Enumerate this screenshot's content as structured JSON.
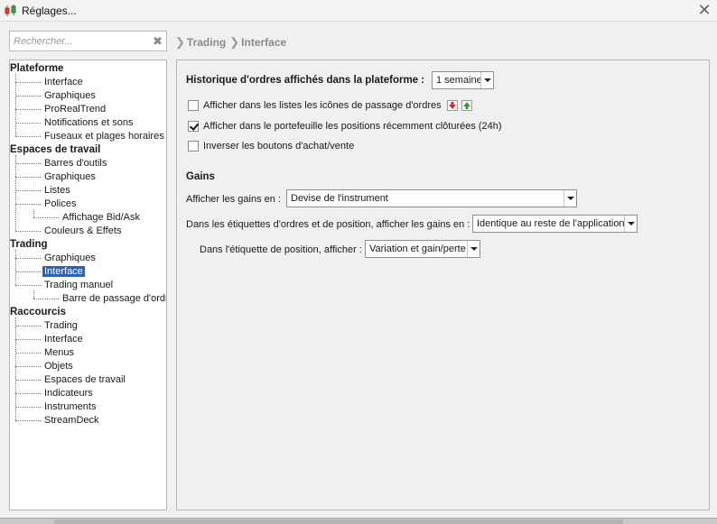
{
  "window": {
    "title": "Réglages..."
  },
  "search": {
    "placeholder": "Rechercher..."
  },
  "breadcrumb": [
    "Trading",
    "Interface"
  ],
  "tree": [
    {
      "label": "Plateforme",
      "level": 0,
      "name": "tree-cat-plateforme"
    },
    {
      "label": "Interface",
      "level": 1,
      "name": "tree-item-plateforme-interface"
    },
    {
      "label": "Graphiques",
      "level": 1,
      "name": "tree-item-plateforme-graphiques"
    },
    {
      "label": "ProRealTrend",
      "level": 1,
      "name": "tree-item-prorealtrend"
    },
    {
      "label": "Notifications et sons",
      "level": 1,
      "name": "tree-item-notifications"
    },
    {
      "label": "Fuseaux et plages horaires",
      "level": 1,
      "name": "tree-item-fuseaux"
    },
    {
      "label": "Espaces de travail",
      "level": 0,
      "name": "tree-cat-espaces-de-travail"
    },
    {
      "label": "Barres d'outils",
      "level": 1,
      "name": "tree-item-barres-outils"
    },
    {
      "label": "Graphiques",
      "level": 1,
      "name": "tree-item-espaces-graphiques"
    },
    {
      "label": "Listes",
      "level": 1,
      "name": "tree-item-listes"
    },
    {
      "label": "Polices",
      "level": 1,
      "name": "tree-item-polices"
    },
    {
      "label": "Affichage Bid/Ask",
      "level": 2,
      "name": "tree-item-affichage-bid-ask"
    },
    {
      "label": "Couleurs & Effets",
      "level": 1,
      "name": "tree-item-couleurs-effets"
    },
    {
      "label": "Trading",
      "level": 0,
      "name": "tree-cat-trading"
    },
    {
      "label": "Graphiques",
      "level": 1,
      "name": "tree-item-trading-graphiques"
    },
    {
      "label": "Interface",
      "level": 1,
      "name": "tree-item-trading-interface",
      "selected": true
    },
    {
      "label": "Trading manuel",
      "level": 1,
      "name": "tree-item-trading-manuel"
    },
    {
      "label": "Barre de passage d'ordres",
      "level": 2,
      "name": "tree-item-barre-passage-ordres"
    },
    {
      "label": "Raccourcis",
      "level": 0,
      "name": "tree-cat-raccourcis"
    },
    {
      "label": "Trading",
      "level": 1,
      "name": "tree-item-raccourcis-trading"
    },
    {
      "label": "Interface",
      "level": 1,
      "name": "tree-item-raccourcis-interface"
    },
    {
      "label": "Menus",
      "level": 1,
      "name": "tree-item-menus"
    },
    {
      "label": "Objets",
      "level": 1,
      "name": "tree-item-objets"
    },
    {
      "label": "Espaces de travail",
      "level": 1,
      "name": "tree-item-raccourcis-espaces"
    },
    {
      "label": "Indicateurs",
      "level": 1,
      "name": "tree-item-indicateurs"
    },
    {
      "label": "Instruments",
      "level": 1,
      "name": "tree-item-instruments"
    },
    {
      "label": "StreamDeck",
      "level": 1,
      "name": "tree-item-streamdeck"
    }
  ],
  "panel": {
    "history_label": "Historique d'ordres affichés dans la plateforme :",
    "history_value": "1 semaine",
    "checkboxes": [
      {
        "label": "Afficher dans les listes les icônes de passage d'ordres",
        "checked": false
      },
      {
        "label": "Afficher dans le portefeuille les positions récemment clôturées (24h)",
        "checked": true
      },
      {
        "label": "Inverser les boutons d'achat/vente",
        "checked": false
      }
    ],
    "gains_title": "Gains",
    "gains_display_label": "Afficher les gains en :",
    "gains_display_value": "Devise de l'instrument",
    "labels_gains_label": "Dans les étiquettes d'ordres et de position, afficher les gains en :",
    "labels_gains_value": "Identique au reste de l'application",
    "position_label_label": "Dans l'étiquette de position, afficher :",
    "position_label_value": "Variation et gain/perte"
  },
  "icons": {
    "app": "candlestick-icon",
    "close": "close-icon",
    "search_clear": "clear-search-icon",
    "sell_order": "sell-order-icon",
    "buy_order": "buy-order-icon"
  },
  "colors": {
    "selection": "#2a62b8",
    "sell": "#d62828",
    "buy": "#2e9e35"
  }
}
